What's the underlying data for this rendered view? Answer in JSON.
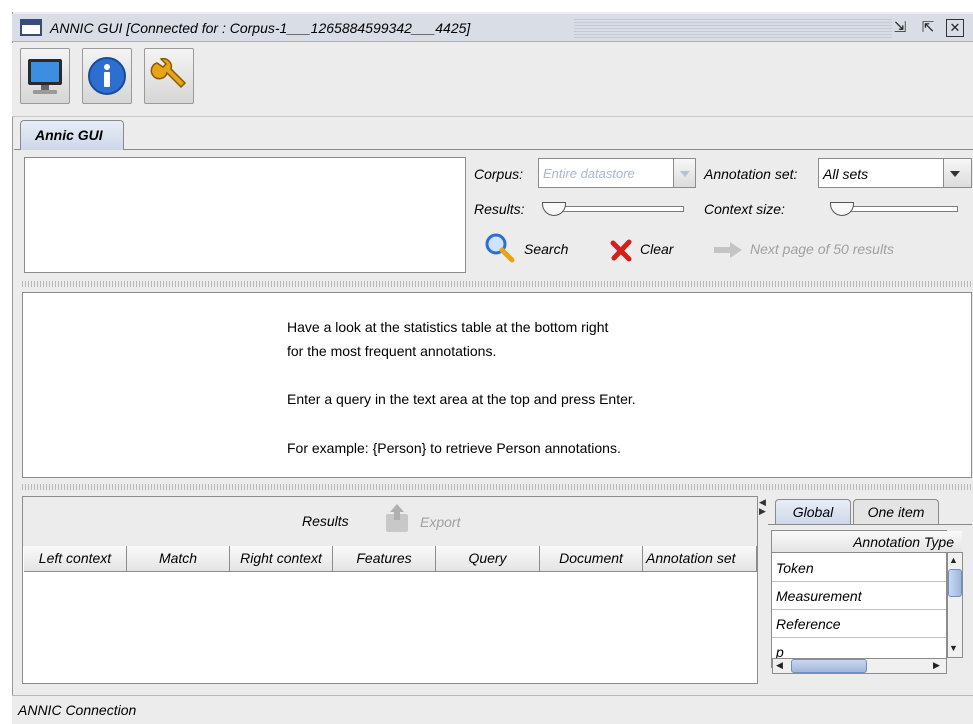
{
  "window": {
    "title": "ANNIC GUI [Connected for : Corpus-1___1265884599342___4425]"
  },
  "toolbar": {
    "buttons": [
      {
        "icon": "monitor-icon"
      },
      {
        "icon": "info-icon"
      },
      {
        "icon": "wrench-icon"
      }
    ]
  },
  "tabs": [
    {
      "label": "Annic GUI"
    }
  ],
  "search": {
    "corpus_label": "Corpus:",
    "corpus_value": "Entire datastore",
    "annotation_set_label": "Annotation set:",
    "annotation_set_value": "All sets",
    "results_label": "Results:",
    "context_size_label": "Context size:",
    "search_label": "Search",
    "clear_label": "Clear",
    "next_page_label": "Next page of 50 results"
  },
  "message": {
    "line1": "Have a look at the statistics table at the bottom right",
    "line2": "for the most frequent annotations.",
    "line3": "Enter a query in the text area at the top and press Enter.",
    "line4": "For example: {Person} to retrieve Person annotations."
  },
  "results": {
    "title": "Results",
    "export_label": "Export",
    "columns": [
      "Left context",
      "Match",
      "Right context",
      "Features",
      "Query",
      "Document",
      "Annotation set"
    ]
  },
  "statistics": {
    "tabs": [
      "Global",
      "One item"
    ],
    "header": "Annotation Type",
    "rows": [
      "Token",
      "Measurement",
      "Reference",
      "p"
    ]
  },
  "status": {
    "text": "ANNIC Connection"
  },
  "colors": {
    "accent_blue": "#2c6fd1",
    "clear_red": "#d41f1f",
    "disabled_text": "#a9b7cf"
  }
}
